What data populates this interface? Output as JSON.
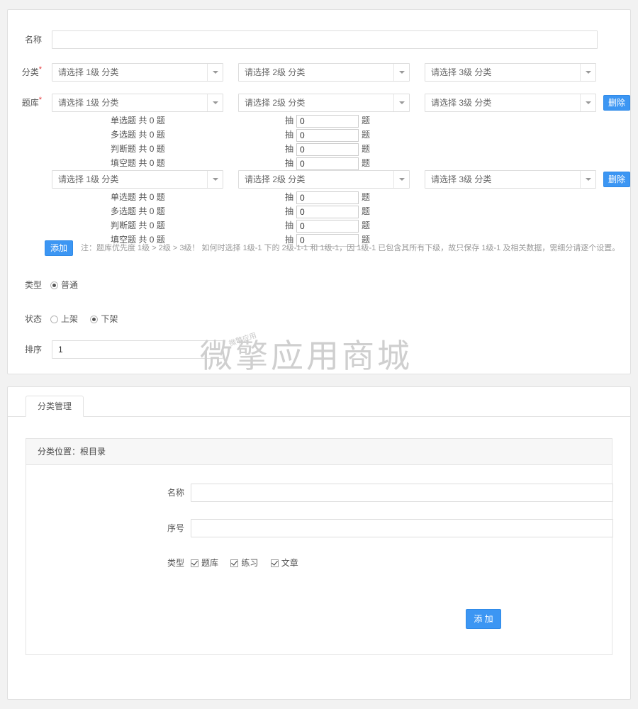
{
  "top_form": {
    "name_label": "名称",
    "name_value": "",
    "name_placeholder": "",
    "category_label": "分类",
    "category_required": "*",
    "bank_label": "题库",
    "bank_required": "*",
    "select_level1_placeholder": "请选择 1级 分类",
    "select_level2_placeholder": "请选择 2级 分类",
    "select_level3_placeholder": "请选择 3级 分类",
    "delete_button": "删除",
    "add_button": "添加",
    "note": "注：题库优先度 1级 > 2级 > 3级！ 如何时选择 1级-1 下的 2级-1-1 和 1级-1，因 1级-1 已包含其所有下级，故只保存 1级-1 及相关数据，需细分请逐个设置。",
    "pick_prefix": "抽",
    "pick_suffix": "题",
    "question_types": [
      {
        "name": "单选题",
        "count_text": "共 0 题",
        "pick_value": "0"
      },
      {
        "name": "多选题",
        "count_text": "共 0 题",
        "pick_value": "0"
      },
      {
        "name": "判断题",
        "count_text": "共 0 题",
        "pick_value": "0"
      },
      {
        "name": "填空题",
        "count_text": "共 0 题",
        "pick_value": "0"
      }
    ],
    "type_label": "类型",
    "type_options": [
      {
        "label": "普通",
        "checked": true
      }
    ],
    "status_label": "状态",
    "status_options": [
      {
        "label": "上架",
        "checked": false
      },
      {
        "label": "下架",
        "checked": true
      }
    ],
    "order_label": "排序",
    "order_value": "1"
  },
  "watermark": {
    "text": "微擎应用商城",
    "small_text": "微擎应用"
  },
  "bottom_card": {
    "tab_label": "分类管理",
    "panel_title": "分类位置：根目录",
    "name_label": "名称",
    "name_value": "",
    "seq_label": "序号",
    "seq_value": "",
    "type_label": "类型",
    "type_options": [
      {
        "label": "题库",
        "checked": true
      },
      {
        "label": "练习",
        "checked": true
      },
      {
        "label": "文章",
        "checked": true
      }
    ],
    "add_button": "添 加"
  },
  "colors": {
    "accent": "#3c96f3",
    "required": "#e4393c",
    "border": "#e0e0e0",
    "watermark": "#cfcfcf"
  }
}
